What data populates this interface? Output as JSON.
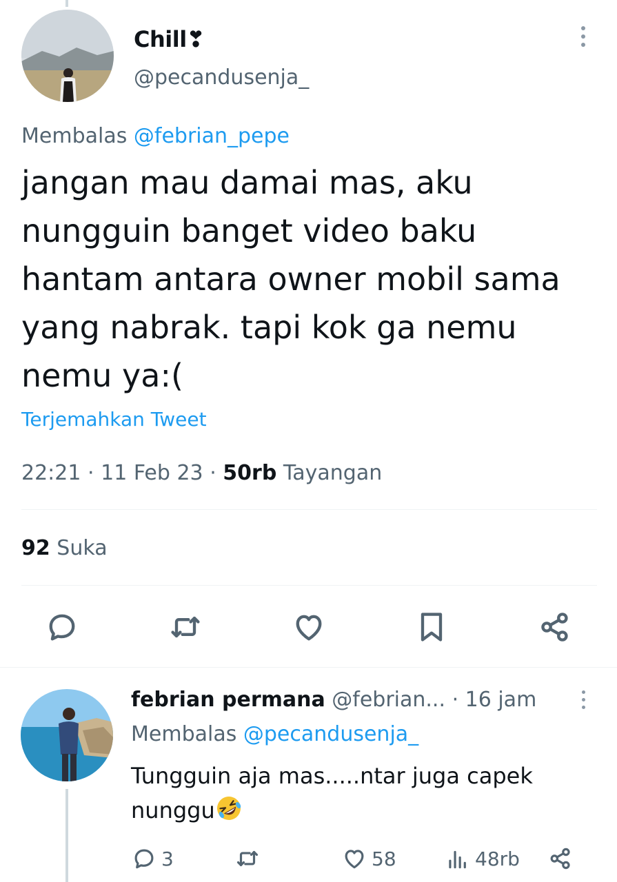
{
  "tweet": {
    "display_name": "Chill❣",
    "handle": "@pecandusenja_",
    "reply_prefix": "Membalas",
    "reply_to": "@febrian_pepe",
    "text": "jangan mau damai mas, aku nungguin banget video baku hantam antara owner mobil sama yang nabrak. tapi kok ga nemu nemu ya:(",
    "translate_label": "Terjemahkan Tweet",
    "time": "22:21",
    "separator": "·",
    "date": "11 Feb 23",
    "views_count": "50rb",
    "views_label": "Tayangan",
    "likes_count": "92",
    "likes_label": "Suka",
    "actions": [
      "reply-icon",
      "retweet-icon",
      "like-icon",
      "bookmark-icon",
      "share-icon"
    ]
  },
  "reply": {
    "display_name": "febrian permana",
    "handle": "@febrian...",
    "time": "· 16 jam",
    "reply_prefix": "Membalas",
    "reply_to": "@pecandusenja_",
    "text": "Tungguin aja mas.....ntar juga capek nunggu",
    "emoji": "rolling-on-floor-laughing",
    "reply_count": "3",
    "like_count": "58",
    "views_count": "48rb",
    "actions": [
      "reply-icon",
      "retweet-icon",
      "like-icon",
      "views-icon",
      "share-icon"
    ]
  },
  "colors": {
    "text_primary": "#0f1419",
    "text_secondary": "#536471",
    "accent": "#1d9bf0",
    "divider": "#eff3f4",
    "icon": "#536471"
  }
}
